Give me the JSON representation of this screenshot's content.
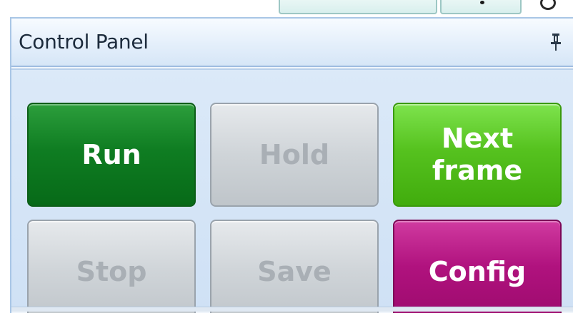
{
  "panel": {
    "title": "Control Panel",
    "pin_icon": "pin-icon"
  },
  "buttons": {
    "run": {
      "label": "Run",
      "state": "enabled",
      "color": "#0f7d22"
    },
    "hold": {
      "label": "Hold",
      "state": "disabled",
      "color": "#cfd4d8"
    },
    "next": {
      "label": "Next\nframe",
      "state": "enabled",
      "color": "#56c21f"
    },
    "stop": {
      "label": "Stop",
      "state": "disabled",
      "color": "#cfd4d8"
    },
    "save": {
      "label": "Save",
      "state": "disabled",
      "color": "#cfd4d8"
    },
    "config": {
      "label": "Config",
      "state": "enabled",
      "color": "#b0127e"
    }
  },
  "colors": {
    "panel_header": "#e4effb",
    "panel_body": "#d6e6f7",
    "panel_border": "#a9c6e6",
    "title_text": "#1c2b3c"
  }
}
